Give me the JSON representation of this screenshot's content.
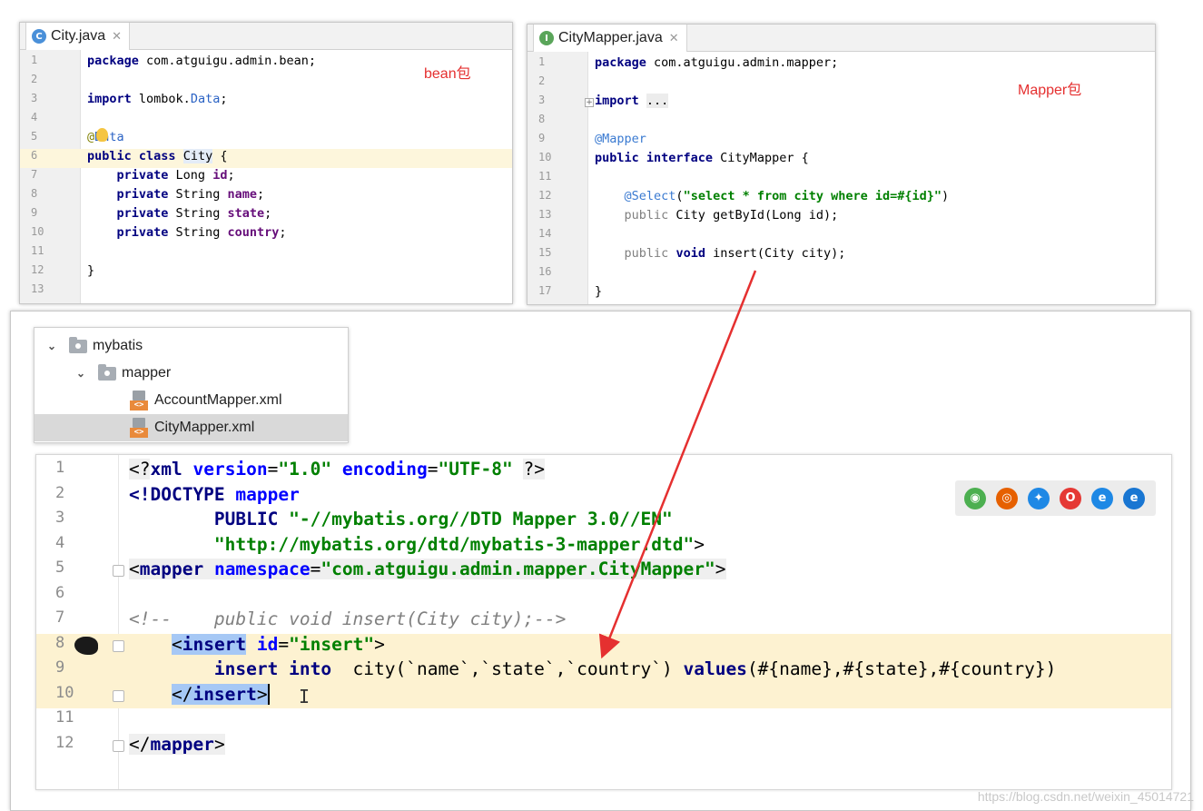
{
  "city_panel": {
    "tab_label": "City.java",
    "icon_letter": "C",
    "annotation": "bean包",
    "lines": [
      {
        "n": "1",
        "html": "<span class='kw'>package</span> com.atguigu.admin.bean;"
      },
      {
        "n": "2",
        "html": ""
      },
      {
        "n": "3",
        "html": "<span class='kw'>import</span> lombok.<span class='typeblue'>Data</span>;"
      },
      {
        "n": "4",
        "html": ""
      },
      {
        "n": "5",
        "html": "<span class='ann'>@</span><span class='typeblue'>Data</span>"
      },
      {
        "n": "6",
        "html": "<span class='kw'>public class</span> <span style='background:#e4ecf7'>City</span> {"
      },
      {
        "n": "7",
        "html": "    <span class='kw'>private</span> Long <span class='field'>id</span>;"
      },
      {
        "n": "8",
        "html": "    <span class='kw'>private</span> String <span class='field'>name</span>;"
      },
      {
        "n": "9",
        "html": "    <span class='kw'>private</span> String <span class='field'>state</span>;"
      },
      {
        "n": "10",
        "html": "    <span class='kw'>private</span> String <span class='field'>country</span>;"
      },
      {
        "n": "11",
        "html": ""
      },
      {
        "n": "12",
        "html": "}"
      },
      {
        "n": "13",
        "html": ""
      }
    ]
  },
  "mapper_panel": {
    "tab_label": "CityMapper.java",
    "icon_letter": "I",
    "annotation": "Mapper包",
    "lines": [
      {
        "n": "1",
        "html": "<span class='kw'>package</span> com.atguigu.admin.mapper;"
      },
      {
        "n": "2",
        "html": ""
      },
      {
        "n": "3",
        "html": "<span class='kw'>import</span> <span style='background:#ececec'>...</span>"
      },
      {
        "n": "8",
        "html": ""
      },
      {
        "n": "9",
        "html": "<span class='ann-blue'>@Mapper</span>"
      },
      {
        "n": "10",
        "html": "<span class='kw'>public interface</span> CityMapper {"
      },
      {
        "n": "11",
        "html": ""
      },
      {
        "n": "12",
        "html": "    <span class='ann-blue'>@Select</span>(<span class='str'>\"select * from city where id=#{id}\"</span>)"
      },
      {
        "n": "13",
        "html": "    <span class='gray'>public</span> City getById(Long id);"
      },
      {
        "n": "14",
        "html": ""
      },
      {
        "n": "15",
        "html": "    <span class='gray'>public</span> <span class='kw'>void</span> insert(City city);"
      },
      {
        "n": "16",
        "html": ""
      },
      {
        "n": "17",
        "html": "}"
      }
    ]
  },
  "tree": {
    "items": [
      {
        "label": "mybatis",
        "kind": "folder",
        "expanded": true
      },
      {
        "label": "mapper",
        "kind": "folder",
        "expanded": true
      },
      {
        "label": "AccountMapper.xml",
        "kind": "xml"
      },
      {
        "label": "CityMapper.xml",
        "kind": "xml",
        "selected": true
      }
    ]
  },
  "xml_editor": {
    "lines": [
      {
        "n": "1",
        "html": "<span class='tagbg'>&lt;?</span><span class='tagc'>xml</span> <span class='attr'>version</span>=<span class='xstr'>\"1.0\"</span> <span class='attr'>encoding</span>=<span class='xstr'>\"UTF-8\"</span> <span class='tagbg'>?&gt;</span>"
      },
      {
        "n": "2",
        "html": "<span class='tagc'>&lt;!DOCTYPE</span> <span class='attr'>mapper</span>"
      },
      {
        "n": "3",
        "html": "        <span class='tagc'>PUBLIC</span> <span class='xstr'>\"-//mybatis.org//DTD Mapper 3.0//EN\"</span>"
      },
      {
        "n": "4",
        "html": "        <span class='xstr'>\"http://mybatis.org/dtd/mybatis-3-mapper.dtd\"</span>&gt;"
      },
      {
        "n": "5",
        "html": "<span class='tagbg'>&lt;<span class='tagc'>mapper</span> <span class='attr'>namespace</span>=<span class='xstr'>\"com.atguigu.admin.mapper.CityMapper\"</span>&gt;</span>"
      },
      {
        "n": "6",
        "html": ""
      },
      {
        "n": "7",
        "html": "<span class='comment'>&lt;!--    public void insert(City city);--&gt;</span>"
      },
      {
        "n": "8",
        "html": "    <span class='sel'>&lt;<span class='tagc'>insert</span></span> <span class='attr'>id</span>=<span class='xstr'>\"insert\"</span>&gt;",
        "hl": true
      },
      {
        "n": "9",
        "html": "        <span class='sqlkw'>insert into</span>  city(`name`,`state`,`country`) <span class='sqlkw'>values</span>(#{name},#{state},#{country})",
        "hl": true
      },
      {
        "n": "10",
        "html": "    <span class='sel'>&lt;/<span class='tagc'>insert</span>&gt;</span><span style='border-left:2px solid #000'></span>",
        "hl": true
      },
      {
        "n": "11",
        "html": ""
      },
      {
        "n": "12",
        "html": "<span class='tagbg'>&lt;/<span class='tagc'>mapper</span>&gt;</span>"
      }
    ]
  },
  "browser_icons": [
    {
      "name": "chrome-icon",
      "color": "#4caf50",
      "glyph": "◉"
    },
    {
      "name": "firefox-icon",
      "color": "#e66000",
      "glyph": "◎"
    },
    {
      "name": "safari-icon",
      "color": "#1e88e5",
      "glyph": "✦"
    },
    {
      "name": "opera-icon",
      "color": "#e53935",
      "glyph": "O"
    },
    {
      "name": "ie-icon",
      "color": "#1e88e5",
      "glyph": "e"
    },
    {
      "name": "edge-icon",
      "color": "#1976d2",
      "glyph": "e"
    }
  ],
  "watermark": "https://blog.csdn.net/weixin_45014721",
  "colors": {
    "accent_red": "#e53030",
    "line_highlight": "#fdf2d1",
    "selection": "#a6c8f5"
  }
}
